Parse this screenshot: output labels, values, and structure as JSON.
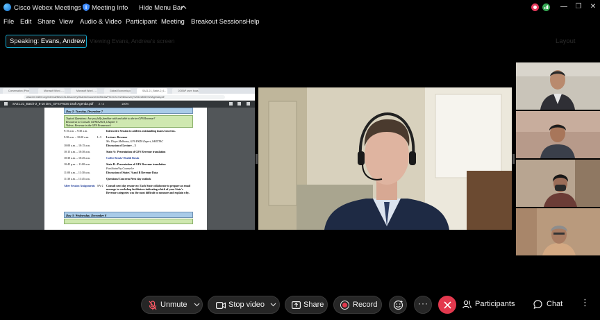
{
  "titlebar": {
    "app_title": "Cisco Webex Meetings",
    "meeting_info": "Meeting Info",
    "hide_menu": "Hide Menu Bar"
  },
  "menu": [
    "File",
    "Edit",
    "Share",
    "View",
    "Audio & Video",
    "Participant",
    "Meeting",
    "Breakout Sessions",
    "Help"
  ],
  "speaking": {
    "label": "Speaking:",
    "name": "Evans, Andrew",
    "ghost": "Viewing Evans, Andrew's screen"
  },
  "layout_label": "Layout",
  "shared_screen": {
    "tabs": [
      "Conversation (Priva...",
      "Microsoft Word - ...",
      "Microsoft Word - ...",
      "Global Economic.pdf",
      "SA21.21_Batch-2_6...",
      "COBAP user: busa..."
    ],
    "url": "www.imf.int/imf.org/external/files/CSL/Discovery/Shared/Documents/Media/PSO/CSL%20Discovery%20DraftSD%20Agenda.pdf",
    "pdf_title": "SA21.21_Batch-2_6-10 Dec_GFS PSDS Draft Agenda.pdf",
    "page": "2 / 4",
    "zoom": "100%",
    "doc": {
      "day_header": "Day 2: Tuesday, December 7",
      "topical_questions": "Topical Questions: Are you fully familiar with and able to derive GFS Revenue?",
      "resources": "Resources to Consult: GFSM 2014, Chapter 5",
      "videos": "Videos: Revenue in the GFS Framework",
      "rows": [
        {
          "time": "9:15 a.m. – 9:30 a.m.",
          "num": "",
          "session": "Interactive Session to address outstanding issues/concerns.",
          "bold": true,
          "blue": false
        },
        {
          "time": "9:30 a.m. – 10:00 a.m.",
          "num": "L-3",
          "session": "Lecture: Revenue",
          "bold": true,
          "blue": false
        },
        {
          "time": "",
          "num": "",
          "session": "Ms. Divya Malhotra, GFS PSDS Expert, SARTTAC",
          "bold": false,
          "blue": false
        },
        {
          "time": "10:00 a.m. – 10:15 a.m.",
          "num": "",
          "session": "Discussion of Lecture – 3",
          "bold": true,
          "blue": false
        },
        {
          "time": "10:15 a.m. – 10:30 a.m.",
          "num": "",
          "session": "State A : Presentation of GFS Revenue translation",
          "bold": true,
          "blue": false
        },
        {
          "time": "10:30 a.m. – 10:45 a.m.",
          "num": "",
          "session": "Coffee Break/ Health Break",
          "bold": true,
          "blue": true
        },
        {
          "time": "10:45 p.m. – 11:00 a.m.",
          "num": "",
          "session": "State B : Presentation of GFS Revenue translation",
          "bold": true,
          "blue": false
        },
        {
          "time": "",
          "num": "",
          "session": "Facilitated by Counselor",
          "bold": false,
          "blue": false
        },
        {
          "time": "11:00 a.m. – 11:30 a.m.",
          "num": "",
          "session": "Discussion of States' A and B Revenue Data",
          "bold": true,
          "blue": false
        },
        {
          "time": "11:30 a.m. – 11:45 a.m.",
          "num": "",
          "session": "Questions/Concerns/Next day outlook",
          "bold": true,
          "blue": false
        },
        {
          "time": "After Session Assignments",
          "num": "SA-2",
          "session": "Consult next day resources: Each State collaborate to prepare an email message to workshop facilitators indicating which of your State's Revenue categories was the most difficult to measure and explain why.",
          "bold": false,
          "blue": true
        }
      ],
      "day3_header": "Day 3: Wednesday, December 8"
    }
  },
  "controls": {
    "mute": "Unmute",
    "video": "Stop video",
    "share": "Share",
    "record": "Record",
    "participants": "Participants",
    "chat": "Chat"
  },
  "colors": {
    "accent": "#13a8cf",
    "end_red": "#e3394e",
    "record_red": "#e3394e",
    "pill_bg": "#262626"
  }
}
